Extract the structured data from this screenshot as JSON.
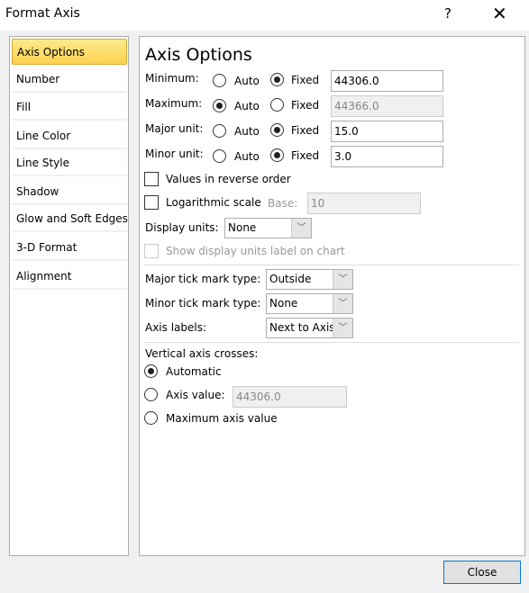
{
  "window": {
    "title": "Format Axis",
    "help": "?",
    "close": "✕"
  },
  "sidebar": {
    "items": [
      {
        "label": "Axis Options",
        "selected": true
      },
      {
        "label": "Number"
      },
      {
        "label": "Fill"
      },
      {
        "label": "Line Color"
      },
      {
        "label": "Line Style"
      },
      {
        "label": "Shadow"
      },
      {
        "label": "Glow and Soft Edges"
      },
      {
        "label": "3-D Format"
      },
      {
        "label": "Alignment"
      }
    ]
  },
  "main": {
    "heading": "Axis Options",
    "auto_label": "Auto",
    "fixed_label": "Fixed",
    "rows": [
      {
        "label": "Minimum:",
        "mode": "Fixed",
        "value": "44306.0"
      },
      {
        "label": "Maximum:",
        "mode": "Auto",
        "value": "44366.0"
      },
      {
        "label": "Major unit:",
        "mode": "Fixed",
        "value": "15.0"
      },
      {
        "label": "Minor unit:",
        "mode": "Fixed",
        "value": "3.0"
      }
    ],
    "reverse_label": "Values in reverse order",
    "reverse_checked": false,
    "log_label": "Logarithmic scale",
    "log_checked": false,
    "base_label": "Base:",
    "base_value": "10",
    "display_units_label": "Display units:",
    "display_units_value": "None",
    "show_units_label": "Show display units label on chart",
    "major_tick_label": "Major tick mark type:",
    "major_tick_value": "Outside",
    "minor_tick_label": "Minor tick mark type:",
    "minor_tick_value": "None",
    "axis_labels_label": "Axis labels:",
    "axis_labels_value": "Next to Axis",
    "crosses_label": "Vertical axis crosses:",
    "automatic_label": "Automatic",
    "axis_value_label": "Axis value:",
    "axis_value": "44306.0",
    "max_axis_label": "Maximum axis value",
    "crosses_selected": "Automatic"
  },
  "footer": {
    "close_label": "Close"
  }
}
